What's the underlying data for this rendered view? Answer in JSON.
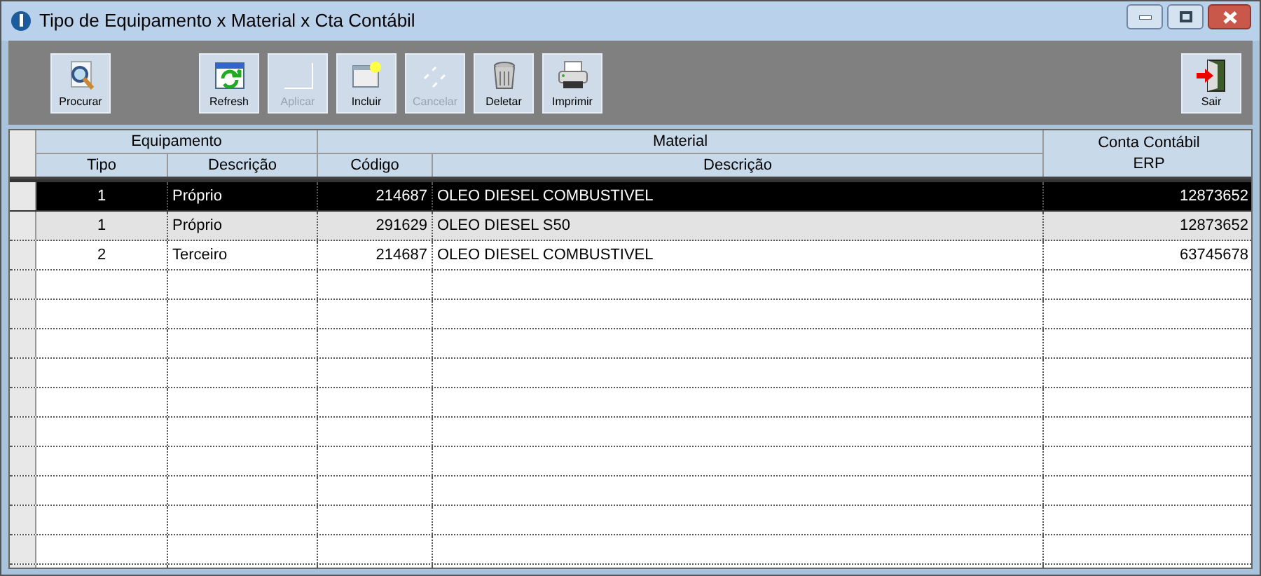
{
  "window": {
    "title": "Tipo de Equipamento x Material x Cta Contábil"
  },
  "toolbar": {
    "search_buttons": [
      {
        "kind": "search",
        "label": "Procurar",
        "disabled": false
      }
    ],
    "action_buttons": [
      {
        "kind": "refresh",
        "label": "Refresh",
        "disabled": false
      },
      {
        "kind": "apply",
        "label": "Aplicar",
        "disabled": true
      },
      {
        "kind": "new",
        "label": "Incluir",
        "disabled": false
      },
      {
        "kind": "cancel",
        "label": "Cancelar",
        "disabled": true
      },
      {
        "kind": "delete",
        "label": "Deletar",
        "disabled": false
      },
      {
        "kind": "print",
        "label": "Imprimir",
        "disabled": false
      }
    ],
    "exit_buttons": [
      {
        "kind": "exit",
        "label": "Sair",
        "disabled": false
      }
    ]
  },
  "table": {
    "groups": [
      "Equipamento",
      "Material",
      "Conta Contábil"
    ],
    "columns": [
      "Tipo",
      "Descrição",
      "Código",
      "Descrição",
      "ERP"
    ],
    "rows": [
      {
        "cells": [
          "1",
          "Próprio",
          "214687",
          "OLEO DIESEL COMBUSTIVEL",
          "12873652"
        ],
        "selected": true,
        "highlighted": false
      },
      {
        "cells": [
          "1",
          "Próprio",
          "291629",
          "OLEO DIESEL S50",
          "12873652"
        ],
        "selected": false,
        "highlighted": true
      },
      {
        "cells": [
          "2",
          "Terceiro",
          "214687",
          "OLEO DIESEL COMBUSTIVEL",
          "63745678"
        ],
        "selected": false,
        "highlighted": false
      }
    ]
  }
}
